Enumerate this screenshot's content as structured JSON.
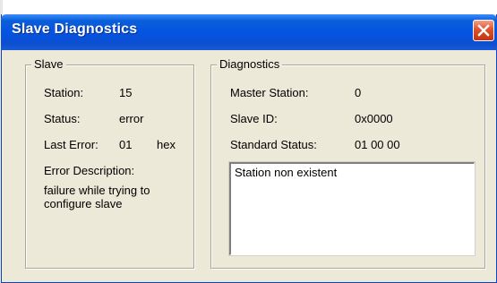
{
  "window": {
    "title": "Slave Diagnostics",
    "accent_color": "#0554e3",
    "close_icon": "close-icon"
  },
  "slave": {
    "legend": "Slave",
    "station_label": "Station:",
    "station_value": "15",
    "status_label": "Status:",
    "status_value": "error",
    "last_error_label": "Last Error:",
    "last_error_value": "01",
    "last_error_unit": "hex",
    "error_description_label": "Error Description:",
    "error_description_value": "failure while trying to configure slave"
  },
  "diagnostics": {
    "legend": "Diagnostics",
    "master_station_label": "Master Station:",
    "master_station_value": "0",
    "slave_id_label": "Slave ID:",
    "slave_id_value": "0x0000",
    "standard_status_label": "Standard Status:",
    "standard_status_value": "01 00 00",
    "message_text": "Station non existent"
  }
}
